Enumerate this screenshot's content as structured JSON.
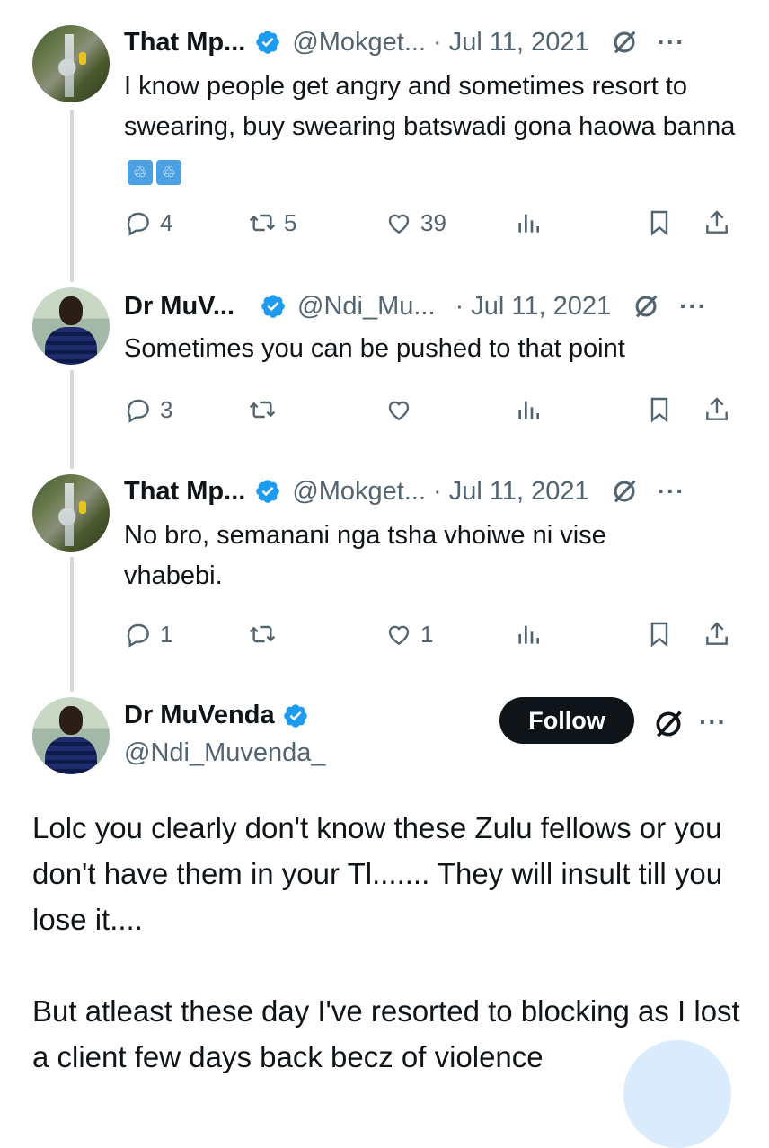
{
  "tweets": [
    {
      "name": "That Mp...",
      "handle": "@Mokget...",
      "date": "Jul 11, 2021",
      "text": "I know people get angry and sometimes resort to swearing, buy swearing batswadi gona haowa banna",
      "emoji": "🚮🚮",
      "replies": "4",
      "retweets": "5",
      "likes": "39"
    },
    {
      "name": "Dr MuV...",
      "handle": "@Ndi_Mu...",
      "date": "Jul 11, 2021",
      "text": "Sometimes you can be pushed to that point",
      "replies": "3",
      "retweets": "",
      "likes": ""
    },
    {
      "name": "That Mp...",
      "handle": "@Mokget...",
      "date": "Jul 11, 2021",
      "text": "No bro, semanani nga tsha vhoiwe ni vise vhabebi.",
      "replies": "1",
      "retweets": "",
      "likes": "1"
    }
  ],
  "main_tweet": {
    "name": "Dr MuVenda",
    "handle": "@Ndi_Muvenda_",
    "follow_label": "Follow",
    "paragraph1": "Lolc you clearly don't know these Zulu fellows or you don't have them in your Tl....... They will insult till you lose it....",
    "paragraph2": "But atleast these day I've resorted to blocking as I lost a client few days back becz of violence"
  },
  "colors": {
    "verified": "#1d9bf0",
    "secondary_text": "#536471",
    "thread_line": "#cfd9de",
    "follow_bg": "#0f1419"
  },
  "icons": [
    "reply-icon",
    "retweet-icon",
    "like-icon",
    "views-icon",
    "bookmark-icon",
    "share-icon",
    "grok-icon",
    "more-icon",
    "verified-badge-icon"
  ]
}
